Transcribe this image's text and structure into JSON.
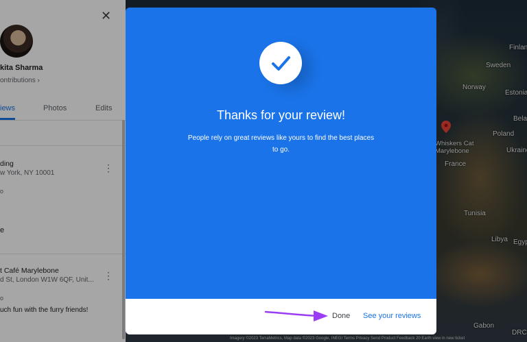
{
  "map": {
    "labels": [
      "Sweden",
      "Norway",
      "Finland",
      "Estonia",
      "Belarus",
      "Poland",
      "Ukraine",
      "France",
      "Tunisia",
      "Libya",
      "Egypt",
      "Gabon",
      "DRC"
    ],
    "pin_label": "Whiskers Cat Marylebone",
    "attribution": "Imagery ©2023 TerraMetrics, Map data ©2023 Google, INEGI   Terms   Privacy   Send Product Feedback   20 Earth view in new ticket"
  },
  "panel": {
    "profile_name": "kita Sharma",
    "contributions": "ontributions ›",
    "tabs": {
      "reviews": "iews",
      "photos": "Photos",
      "edits": "Edits"
    },
    "items": [
      {
        "title": "ding",
        "address": "w York, NY 10001"
      },
      {
        "title": "t Café Marylebone",
        "address": "d St, London W1W 6QF, Unit...",
        "snippet": "uch fun with the furry friends!"
      }
    ],
    "item1_small": "o",
    "item1_tail": "e",
    "item2_small": "o"
  },
  "dialog": {
    "title": "Thanks for your review!",
    "message": "People rely on great reviews like yours to find the best places to go.",
    "done_label": "Done",
    "see_reviews_label": "See your reviews"
  },
  "colors": {
    "dialog_blue": "#1a73e8",
    "arrow_purple": "#9b3df5",
    "link_blue": "#1a73e8"
  }
}
